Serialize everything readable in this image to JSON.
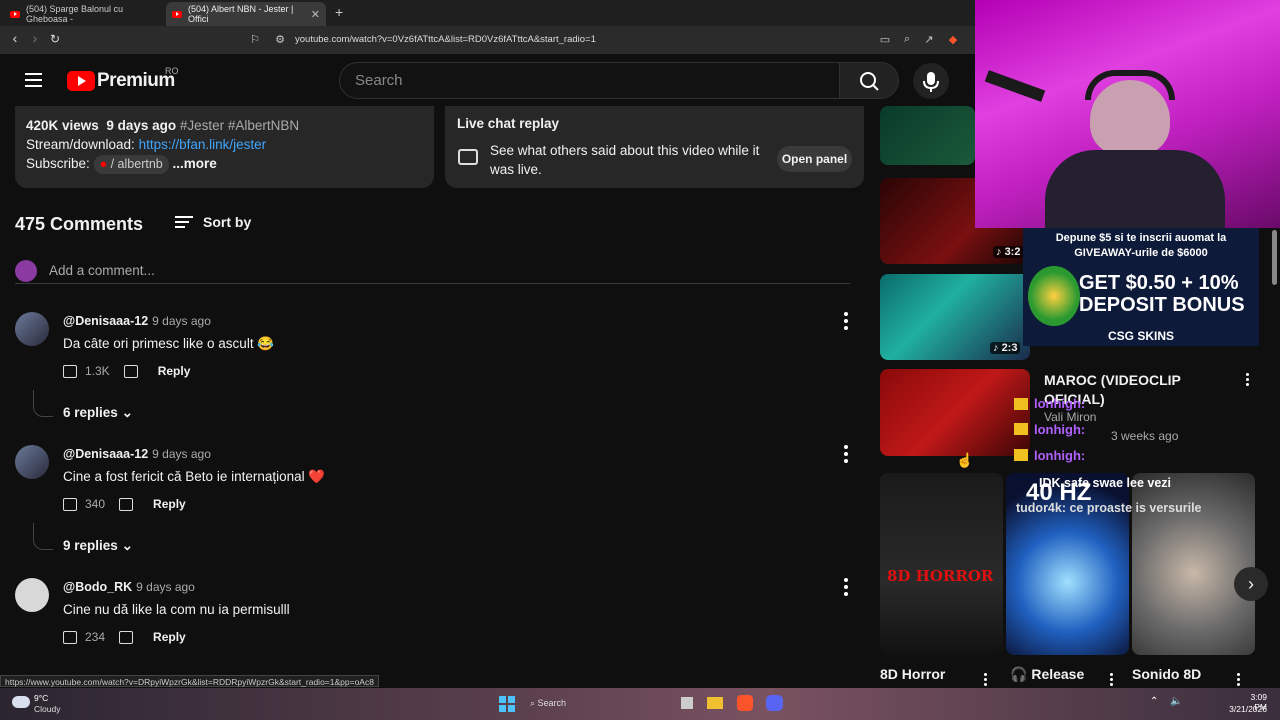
{
  "browser": {
    "tabs": [
      {
        "title": "(504) Sparge Balonul cu Gheboasa -"
      },
      {
        "title": "(504) Albert NBN - Jester | Offici"
      }
    ],
    "new_tab": "+",
    "url": "youtube.com/watch?v=0Vz6fATttcA&list=RD0Vz6fATttcA&start_radio=1",
    "status_url": "https://www.youtube.com/watch?v=DRpyiWpzrGk&list=RDDRpyiWpzrGk&start_radio=1&pp=oAc8"
  },
  "youtube": {
    "logo_text": "Premium",
    "country": "RO",
    "search_placeholder": "Search"
  },
  "description": {
    "views": "420K views",
    "date": "9 days ago",
    "tags": "#Jester #AlbertNBN",
    "stream_label": "Stream/download:",
    "stream_link": "https://bfan.link/jester",
    "subscribe_label": "Subscribe:",
    "subscribe_chip": "/ albertnb",
    "more": "...more"
  },
  "live_chat": {
    "title": "Live chat replay",
    "desc": "See what others said about this video while it was live.",
    "button": "Open panel"
  },
  "comments": {
    "count": "475 Comments",
    "sort": "Sort by",
    "add_placeholder": "Add a comment...",
    "items": [
      {
        "author": "@Denisaaa-12",
        "time": "9 days ago",
        "text": "Da câte ori primesc like o ascult 😂",
        "likes": "1.3K",
        "reply": "Reply",
        "replies": "6 replies"
      },
      {
        "author": "@Denisaaa-12",
        "time": "9 days ago",
        "text": "Cine a fost fericit că Beto ie internațional ❤️",
        "likes": "340",
        "reply": "Reply",
        "replies": "9 replies"
      },
      {
        "author": "@Bodo_RK",
        "time": "9 days ago",
        "text": "Cine nu dă like la com nu ia permisulll",
        "likes": "234",
        "reply": "Reply"
      }
    ]
  },
  "sidebar": {
    "durations": [
      "3:2",
      "2:3"
    ],
    "video_title": "MAROC (VIDEOCLIP OFICIAL)",
    "channel": "Vali Miron",
    "age": "3 weeks ago",
    "shelf": [
      {
        "title": "8D Horror",
        "thumb_text": "8D HORROR"
      },
      {
        "title": "Release",
        "thumb_text": "40 HZ"
      },
      {
        "title": "Sonido 8D",
        "thumb_text": ""
      }
    ]
  },
  "overlay": {
    "ad_line1": "Depune $5 si te inscrii auomat la",
    "ad_line2": "GIVEAWAY-urile de $6000",
    "ad_big1": "GET $0.50 + 10%",
    "ad_big2": "DEPOSIT BONUS",
    "ad_brand": "CSG SKINS",
    "chat": [
      {
        "user": "lonhigh:"
      },
      {
        "user": "lonhigh:"
      },
      {
        "user": "lonhigh:"
      },
      {
        "user": "tudor4k:",
        "text": "ce proaste is versurile"
      }
    ],
    "chat_top": "IDK safe swae lee vezi"
  },
  "taskbar": {
    "weather_temp": "9°C",
    "weather_desc": "Cloudy",
    "search": "Search",
    "time": "3:09 PM",
    "date": "3/21/2026"
  }
}
